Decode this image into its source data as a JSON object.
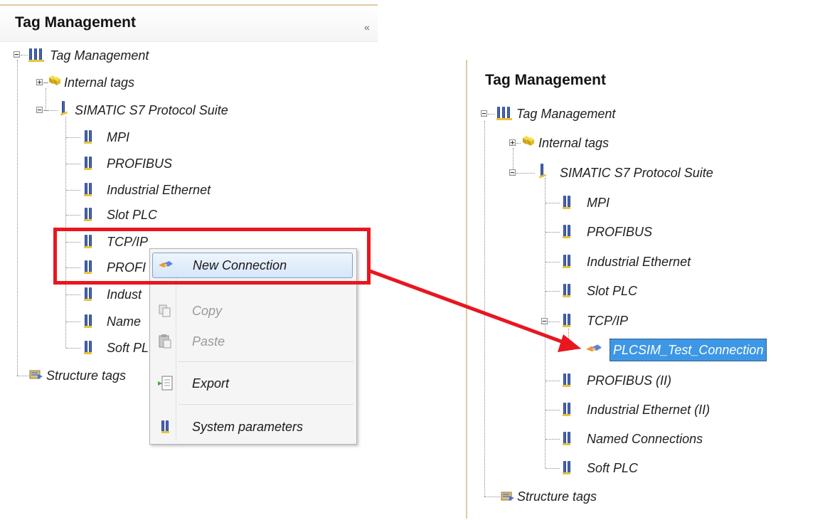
{
  "left": {
    "title": "Tag Management",
    "collapse_glyph": "«",
    "tree": {
      "root": "Tag Management",
      "internal": "Internal tags",
      "suite": "SIMATIC S7 Protocol Suite",
      "channels": [
        "MPI",
        "PROFIBUS",
        "Industrial Ethernet",
        "Slot PLC",
        "TCP/IP",
        "PROFI",
        "Indust",
        "Name",
        "Soft PL"
      ],
      "structure": "Structure tags"
    },
    "context_menu": {
      "new_connection": "New Connection",
      "copy": "Copy",
      "paste": "Paste",
      "export": "Export",
      "system_parameters": "System parameters"
    }
  },
  "right": {
    "title": "Tag Management",
    "tree": {
      "root": "Tag Management",
      "internal": "Internal tags",
      "suite": "SIMATIC S7 Protocol Suite",
      "channels_before": [
        "MPI",
        "PROFIBUS",
        "Industrial Ethernet",
        "Slot PLC"
      ],
      "tcpip": "TCP/IP",
      "new_item": "PLCSIM_Test_Connection",
      "channels_after": [
        "PROFIBUS (II)",
        "Industrial Ethernet (II)",
        "Named Connections",
        "Soft PLC"
      ],
      "structure": "Structure tags"
    }
  },
  "colors": {
    "highlight_red": "#e8161f",
    "selection_blue": "#3d97e6",
    "panel_border": "#e1c9a0"
  },
  "icons": {
    "tag_management": "tag-management-icon",
    "internal_tags": "cube-icon",
    "channel": "channel-icon",
    "connection": "connection-icon",
    "structure": "structure-tags-icon"
  }
}
